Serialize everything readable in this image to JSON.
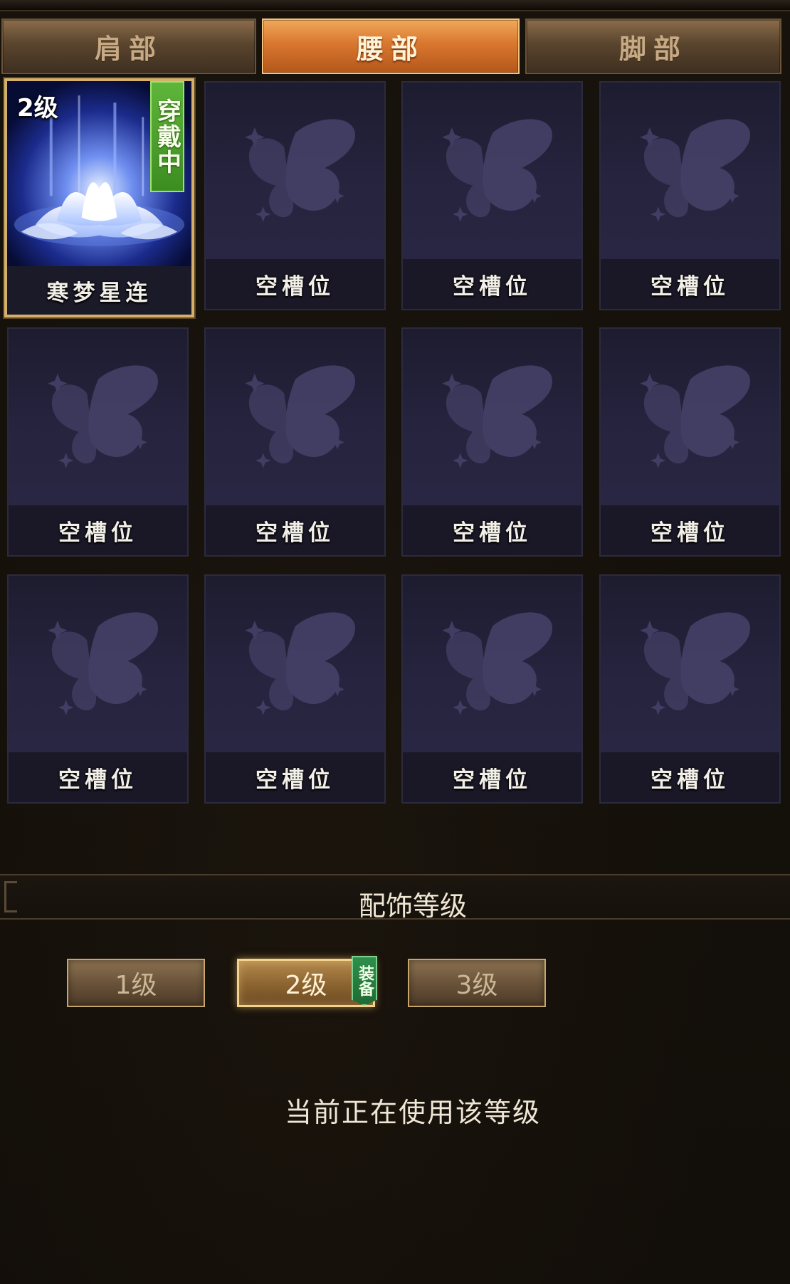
{
  "tabs": [
    {
      "label": "肩部",
      "active": false
    },
    {
      "label": "腰部",
      "active": true
    },
    {
      "label": "脚部",
      "active": false
    }
  ],
  "slots": [
    {
      "label": "寒梦星连",
      "level": "2级",
      "status": "穿戴中",
      "equipped": true
    },
    {
      "label": "空槽位"
    },
    {
      "label": "空槽位"
    },
    {
      "label": "空槽位"
    },
    {
      "label": "空槽位"
    },
    {
      "label": "空槽位"
    },
    {
      "label": "空槽位"
    },
    {
      "label": "空槽位"
    },
    {
      "label": "空槽位"
    },
    {
      "label": "空槽位"
    },
    {
      "label": "空槽位"
    },
    {
      "label": "空槽位"
    }
  ],
  "section": {
    "title": "配饰等级"
  },
  "levels": [
    {
      "label": "1级",
      "active": false
    },
    {
      "label": "2级",
      "active": true,
      "tag": "装备"
    },
    {
      "label": "3级",
      "active": false
    }
  ],
  "status_text": "当前正在使用该等级",
  "colors": {
    "accent": "#d9772f",
    "equipped_green": "#4aa12a",
    "gold_border": "#d4b06a"
  }
}
